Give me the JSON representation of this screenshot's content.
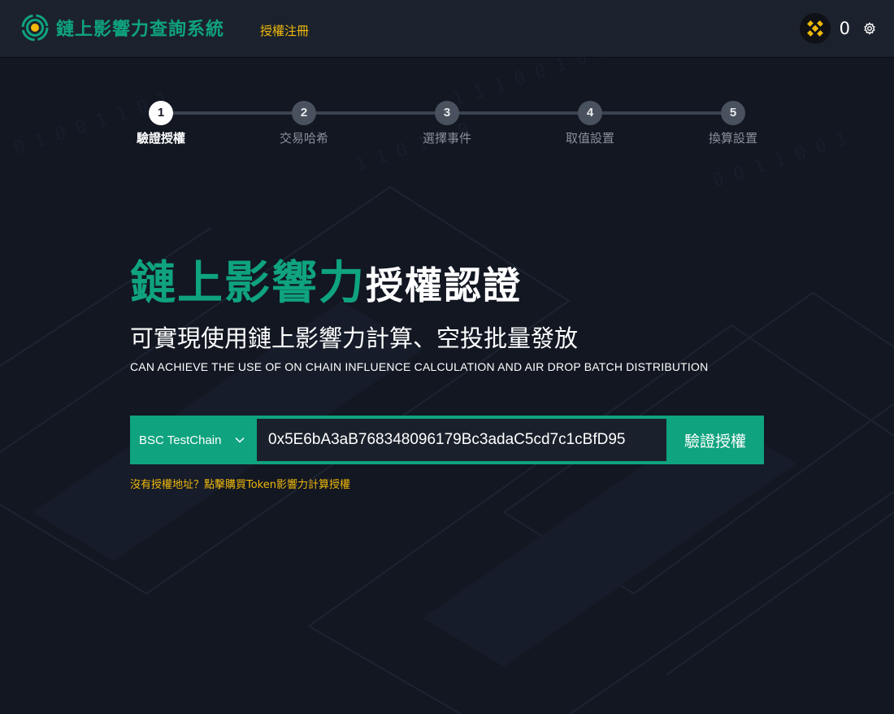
{
  "header": {
    "title": "鏈上影響力查詢系統",
    "register_link": "授權注冊",
    "balance": "0",
    "icons": [
      "brand-logo-icon",
      "bnb-coin-icon",
      "settings-gear-icon"
    ]
  },
  "steps": [
    {
      "number": "1",
      "label": "驗證授權",
      "active": true
    },
    {
      "number": "2",
      "label": "交易哈希",
      "active": false
    },
    {
      "number": "3",
      "label": "選擇事件",
      "active": false
    },
    {
      "number": "4",
      "label": "取值設置",
      "active": false
    },
    {
      "number": "5",
      "label": "換算設置",
      "active": false
    }
  ],
  "hero": {
    "title_green": "鏈上影響力",
    "title_white": "授權認證",
    "subtitle": "可實現使用鏈上影響力計算、空投批量發放",
    "subtitle_en": "CAN ACHIEVE THE USE OF ON CHAIN INFLUENCE CALCULATION AND AIR DROP BATCH DISTRIBUTION"
  },
  "form": {
    "chain": "BSC TestChain",
    "address": "0x5E6bA3aB768348096179Bc3adaC5cd7c1cBfD95",
    "verify_button": "驗證授權",
    "buy_link": "沒有授權地址？點擊購買Token影響力計算授權"
  },
  "colors": {
    "accent": "#0fa37f",
    "gold": "#f0b90b",
    "background": "#121722",
    "header": "#1c222d"
  }
}
